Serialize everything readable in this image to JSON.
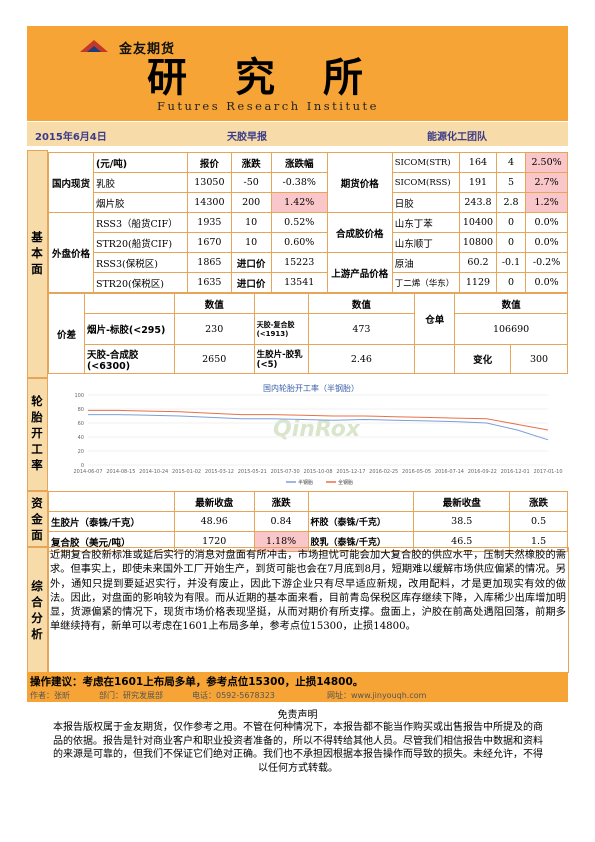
{
  "header": {
    "company": "金友期货",
    "title": "研究所",
    "subtitle": "Futures Research Institute"
  },
  "info": {
    "date": "2015年6月4日",
    "report": "天胶早报",
    "team": "能源化工团队"
  },
  "basic": {
    "section_label": "基本面",
    "domestic_label": "国内现货",
    "foreign_label": "外盘价格",
    "spread_label": "价差",
    "col_unit": "(元/吨)",
    "col_price": "报价",
    "col_change": "涨跌",
    "col_pct": "涨跌幅",
    "domestic": [
      {
        "name": "乳胶",
        "price": "13050",
        "change": "-50",
        "pct": "-0.38%"
      },
      {
        "name": "烟片胶",
        "price": "14300",
        "change": "200",
        "pct": "1.42%"
      }
    ],
    "futures_label": "期货价格",
    "futures": [
      {
        "name": "SICOM(STR)",
        "price": "164",
        "change": "4",
        "pct": "2.50%"
      },
      {
        "name": "SICOM(RSS)",
        "price": "191",
        "change": "5",
        "pct": "2.7%"
      },
      {
        "name": "日胶",
        "price": "243.8",
        "change": "2.8",
        "pct": "1.2%"
      }
    ],
    "foreign": [
      {
        "name": "RSS3（船货CIF）",
        "price": "1935",
        "change": "10",
        "pct": "0.52%"
      },
      {
        "name": "STR20(船货CIF)",
        "price": "1670",
        "change": "10",
        "pct": "0.60%"
      },
      {
        "name": "RSS3(保税区)",
        "price": "1865",
        "imp_label": "进口价",
        "imp": "15223"
      },
      {
        "name": "STR20(保税区)",
        "price": "1635",
        "imp_label": "进口价",
        "imp": "13541"
      }
    ],
    "synthetic_label": "合成胶价格",
    "synthetic": [
      {
        "name": "山东丁苯",
        "price": "10400",
        "change": "0",
        "pct": "0.0%"
      },
      {
        "name": "山东顺丁",
        "price": "10800",
        "change": "0",
        "pct": "0.0%"
      }
    ],
    "upstream_label": "上游产品价格",
    "upstream": [
      {
        "name": "原油",
        "price": "60.2",
        "change": "-0.1",
        "pct": "-0.2%"
      },
      {
        "name": "丁二烯（华东）",
        "price": "1129",
        "change": "0",
        "pct": "0.0%"
      }
    ],
    "value_label": "数值",
    "spreads": [
      {
        "name": "烟片-标胶(<295)",
        "value": "230",
        "name2": "天胶-复合胶(<1913)",
        "value2": "473"
      },
      {
        "name": "天胶-合成胶(<6300)",
        "value": "2650",
        "name2": "生胶片-胶乳(<5)",
        "value2": "2.46"
      }
    ],
    "warehouse_label": "仓单",
    "warehouse": "106690",
    "change_label": "变化",
    "warehouse_change": "300"
  },
  "tire": {
    "section_label": "轮胎开工率",
    "chart_title": "国内轮胎开工率（半钢胎）",
    "watermark": "QinRox"
  },
  "chart_data": {
    "type": "line",
    "title": "国内轮胎开工率（半钢胎）",
    "x": [
      "2014-06-07",
      "2014-08-15",
      "2014-10-24",
      "2015-01-02",
      "2015-03-12",
      "2015-05-21",
      "2015-07-30",
      "2015-10-08",
      "2015-12-17",
      "2016-02-25",
      "2016-05-05",
      "2016-07-14",
      "2016-09-22",
      "2016-12-01",
      "2017-01-10"
    ],
    "ylim": [
      0,
      100
    ],
    "yticks": [
      0,
      20,
      40,
      60,
      80,
      100
    ],
    "series": [
      {
        "name": "半钢胎",
        "color": "#7aa0d8",
        "values": [
          72,
          72,
          71,
          70,
          68,
          66,
          66,
          65,
          64,
          65,
          64,
          63,
          62,
          60,
          50,
          36
        ]
      },
      {
        "name": "全钢胎",
        "color": "#e8704a",
        "values": [
          78,
          78,
          77,
          76,
          74,
          72,
          72,
          71,
          70,
          70,
          69,
          68,
          67,
          66,
          58,
          50
        ]
      }
    ]
  },
  "funds": {
    "section_label": "资金面",
    "col_return": "最新收盘",
    "col_change": "涨跌",
    "rows": [
      {
        "name": "生胶片（泰铢/千克）",
        "value": "48.96",
        "change": "0.84",
        "name2": "杯胶（泰铢/千克）",
        "value2": "38.5",
        "change2": "0.5"
      },
      {
        "name": "复合胶（美元/吨）",
        "value": "1720",
        "change": "1.18%",
        "name2": "胶乳（泰铢/千克）",
        "value2": "46.5",
        "change2": "1.5"
      }
    ]
  },
  "analysis": {
    "section_label": "综合分析",
    "text": "近期复合胶新标准或延后实行的消息对盘面有所冲击，市场担忧可能会加大复合胶的供应水平，压制天然橡胶的需求。但事实上，即使未来国外工厂开始生产，到货可能也会在7月底到8月，短期难以缓解市场供应偏紧的情况。另外，通知只提到要延迟实行，并没有废止，因此下游企业只有尽早适应新规，改用配料，才是更加现实有效的做法。因此，对盘面的影响较为有限。而从近期的基本面来看，目前青岛保税区库存继续下降，入库稀少出库增加明显，货源偏紧的情况下，现货市场价格表现坚挺，从而对期价有所支撑。盘面上，沪胶在前高处遇阻回落，前期多单继续持有，新单可以考虑在1601上布局多单，参考点位15300，止损14800。"
  },
  "advice": "操作建议：考虑在1601上布局多单，参考点位15300，止损14800。",
  "author": {
    "author": "作者：张昕",
    "dept": "部门：研究发展部",
    "phone": "电话：0592-5678323",
    "web": "网址：www.jinyouqh.com"
  },
  "disclaimer": {
    "title": "免责声明",
    "text": "本报告版权属于金友期货，仅作参考之用。不管在何种情况下，本报告都不能当作购买或出售报告中所提及的商品的依据。报告是针对商业客户和职业投资者准备的，所以不得转给其他人员。尽管我们相信报告中数据和资料的来源是可靠的，但我们不保证它们绝对正确。我们也不承担因根据本报告操作而导致的损失。未经允许，不得以任何方式转载。"
  }
}
